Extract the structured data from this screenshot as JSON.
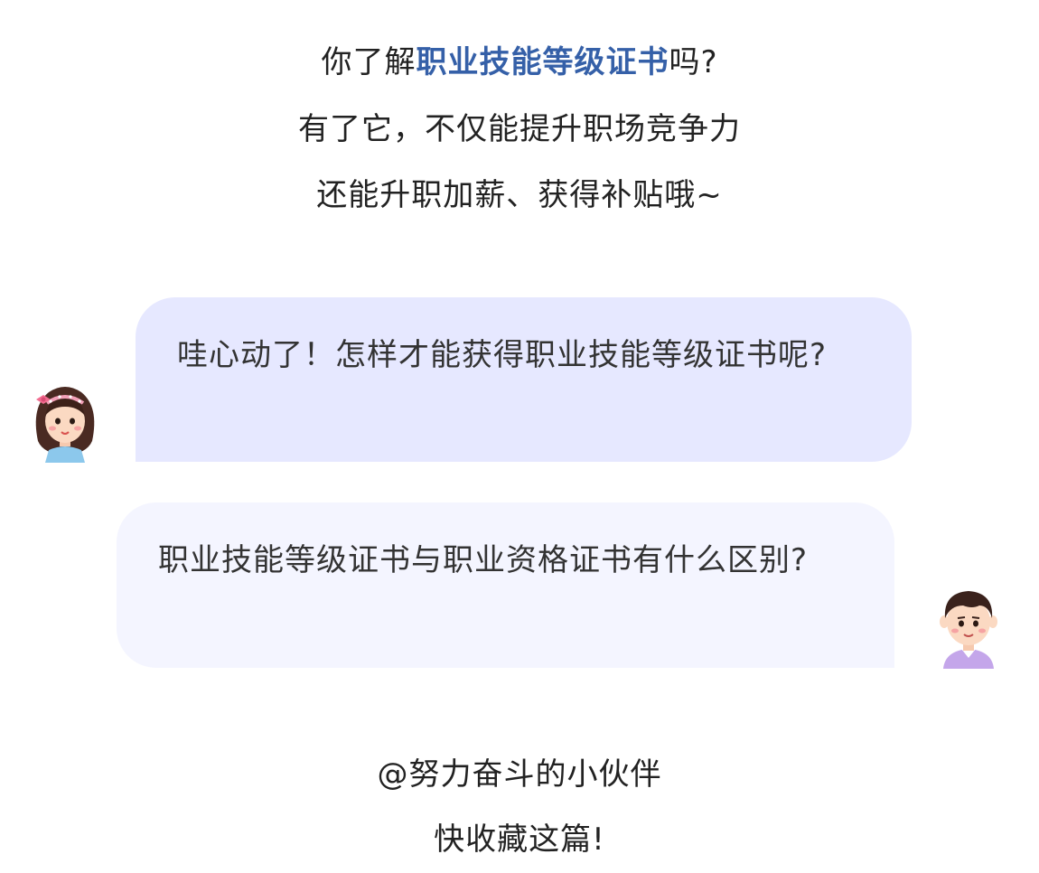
{
  "intro": {
    "line1_prefix": "你了解",
    "line1_highlight": "职业技能等级证书",
    "line1_suffix": "吗?",
    "line2": "有了它，不仅能提升职场竞争力",
    "line3": "还能升职加薪、获得补贴哦~"
  },
  "chat": [
    {
      "speaker_icon": "girl-avatar-icon",
      "text": "哇心动了！怎样才能获得职业技能等级证书呢?"
    },
    {
      "speaker_icon": "boy-avatar-icon",
      "text": "职业技能等级证书与职业资格证书有什么区别?"
    }
  ],
  "outro": {
    "line1": "@努力奋斗的小伙伴",
    "line2": "快收藏这篇!"
  },
  "colors": {
    "highlight": "#3560a8",
    "bubble_girl": "#e6e8ff",
    "bubble_boy": "#f4f5ff",
    "text": "#222222"
  }
}
